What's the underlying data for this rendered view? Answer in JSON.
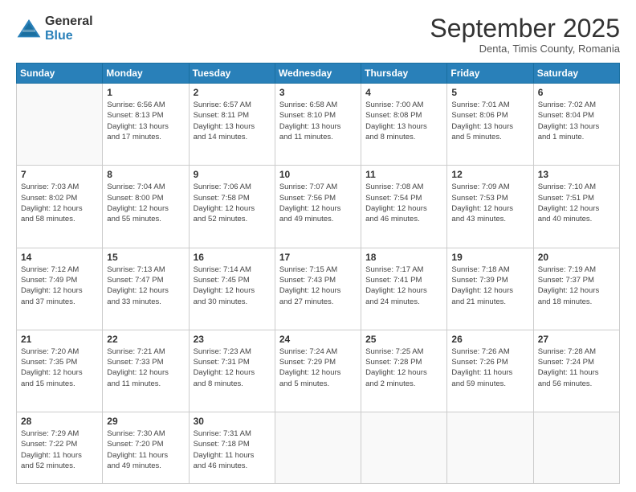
{
  "logo": {
    "general": "General",
    "blue": "Blue"
  },
  "title": "September 2025",
  "location": "Denta, Timis County, Romania",
  "days_of_week": [
    "Sunday",
    "Monday",
    "Tuesday",
    "Wednesday",
    "Thursday",
    "Friday",
    "Saturday"
  ],
  "weeks": [
    [
      {
        "day": "",
        "info": ""
      },
      {
        "day": "1",
        "info": "Sunrise: 6:56 AM\nSunset: 8:13 PM\nDaylight: 13 hours\nand 17 minutes."
      },
      {
        "day": "2",
        "info": "Sunrise: 6:57 AM\nSunset: 8:11 PM\nDaylight: 13 hours\nand 14 minutes."
      },
      {
        "day": "3",
        "info": "Sunrise: 6:58 AM\nSunset: 8:10 PM\nDaylight: 13 hours\nand 11 minutes."
      },
      {
        "day": "4",
        "info": "Sunrise: 7:00 AM\nSunset: 8:08 PM\nDaylight: 13 hours\nand 8 minutes."
      },
      {
        "day": "5",
        "info": "Sunrise: 7:01 AM\nSunset: 8:06 PM\nDaylight: 13 hours\nand 5 minutes."
      },
      {
        "day": "6",
        "info": "Sunrise: 7:02 AM\nSunset: 8:04 PM\nDaylight: 13 hours\nand 1 minute."
      }
    ],
    [
      {
        "day": "7",
        "info": "Sunrise: 7:03 AM\nSunset: 8:02 PM\nDaylight: 12 hours\nand 58 minutes."
      },
      {
        "day": "8",
        "info": "Sunrise: 7:04 AM\nSunset: 8:00 PM\nDaylight: 12 hours\nand 55 minutes."
      },
      {
        "day": "9",
        "info": "Sunrise: 7:06 AM\nSunset: 7:58 PM\nDaylight: 12 hours\nand 52 minutes."
      },
      {
        "day": "10",
        "info": "Sunrise: 7:07 AM\nSunset: 7:56 PM\nDaylight: 12 hours\nand 49 minutes."
      },
      {
        "day": "11",
        "info": "Sunrise: 7:08 AM\nSunset: 7:54 PM\nDaylight: 12 hours\nand 46 minutes."
      },
      {
        "day": "12",
        "info": "Sunrise: 7:09 AM\nSunset: 7:53 PM\nDaylight: 12 hours\nand 43 minutes."
      },
      {
        "day": "13",
        "info": "Sunrise: 7:10 AM\nSunset: 7:51 PM\nDaylight: 12 hours\nand 40 minutes."
      }
    ],
    [
      {
        "day": "14",
        "info": "Sunrise: 7:12 AM\nSunset: 7:49 PM\nDaylight: 12 hours\nand 37 minutes."
      },
      {
        "day": "15",
        "info": "Sunrise: 7:13 AM\nSunset: 7:47 PM\nDaylight: 12 hours\nand 33 minutes."
      },
      {
        "day": "16",
        "info": "Sunrise: 7:14 AM\nSunset: 7:45 PM\nDaylight: 12 hours\nand 30 minutes."
      },
      {
        "day": "17",
        "info": "Sunrise: 7:15 AM\nSunset: 7:43 PM\nDaylight: 12 hours\nand 27 minutes."
      },
      {
        "day": "18",
        "info": "Sunrise: 7:17 AM\nSunset: 7:41 PM\nDaylight: 12 hours\nand 24 minutes."
      },
      {
        "day": "19",
        "info": "Sunrise: 7:18 AM\nSunset: 7:39 PM\nDaylight: 12 hours\nand 21 minutes."
      },
      {
        "day": "20",
        "info": "Sunrise: 7:19 AM\nSunset: 7:37 PM\nDaylight: 12 hours\nand 18 minutes."
      }
    ],
    [
      {
        "day": "21",
        "info": "Sunrise: 7:20 AM\nSunset: 7:35 PM\nDaylight: 12 hours\nand 15 minutes."
      },
      {
        "day": "22",
        "info": "Sunrise: 7:21 AM\nSunset: 7:33 PM\nDaylight: 12 hours\nand 11 minutes."
      },
      {
        "day": "23",
        "info": "Sunrise: 7:23 AM\nSunset: 7:31 PM\nDaylight: 12 hours\nand 8 minutes."
      },
      {
        "day": "24",
        "info": "Sunrise: 7:24 AM\nSunset: 7:29 PM\nDaylight: 12 hours\nand 5 minutes."
      },
      {
        "day": "25",
        "info": "Sunrise: 7:25 AM\nSunset: 7:28 PM\nDaylight: 12 hours\nand 2 minutes."
      },
      {
        "day": "26",
        "info": "Sunrise: 7:26 AM\nSunset: 7:26 PM\nDaylight: 11 hours\nand 59 minutes."
      },
      {
        "day": "27",
        "info": "Sunrise: 7:28 AM\nSunset: 7:24 PM\nDaylight: 11 hours\nand 56 minutes."
      }
    ],
    [
      {
        "day": "28",
        "info": "Sunrise: 7:29 AM\nSunset: 7:22 PM\nDaylight: 11 hours\nand 52 minutes."
      },
      {
        "day": "29",
        "info": "Sunrise: 7:30 AM\nSunset: 7:20 PM\nDaylight: 11 hours\nand 49 minutes."
      },
      {
        "day": "30",
        "info": "Sunrise: 7:31 AM\nSunset: 7:18 PM\nDaylight: 11 hours\nand 46 minutes."
      },
      {
        "day": "",
        "info": ""
      },
      {
        "day": "",
        "info": ""
      },
      {
        "day": "",
        "info": ""
      },
      {
        "day": "",
        "info": ""
      }
    ]
  ]
}
